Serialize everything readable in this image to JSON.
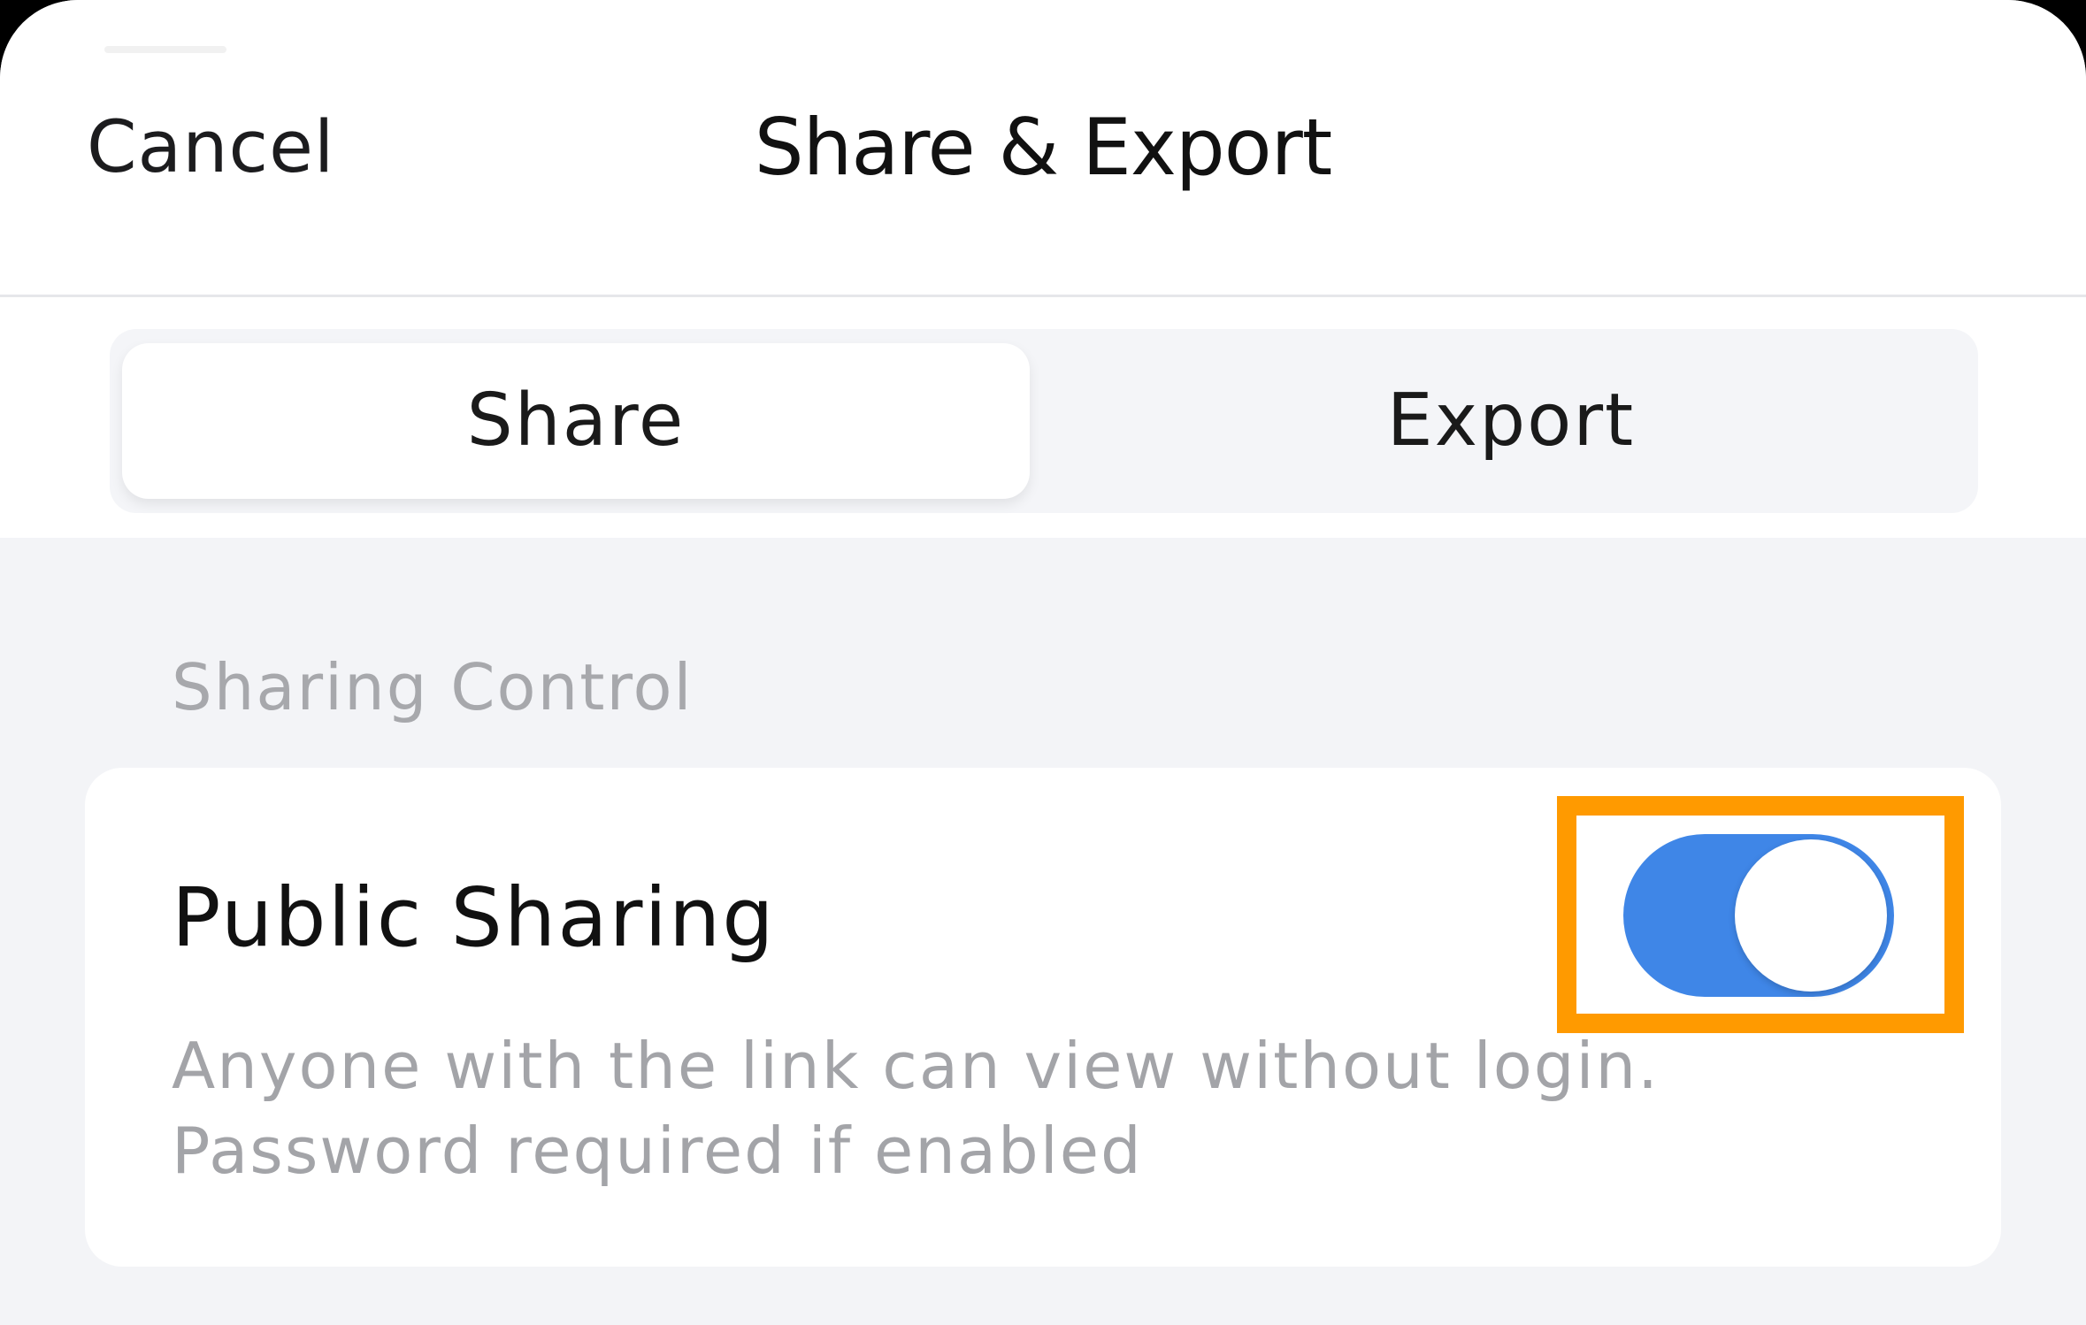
{
  "header": {
    "cancel_label": "Cancel",
    "title": "Share & Export"
  },
  "tabs": [
    {
      "label": "Share",
      "selected": true
    },
    {
      "label": "Export",
      "selected": false
    }
  ],
  "section": {
    "label": "Sharing Control"
  },
  "public_sharing": {
    "title": "Public Sharing",
    "description_line1": "Anyone with the link can view without login.",
    "description_line2": "Password required if enabled",
    "enabled": true,
    "toggle_color": "#3f86e7"
  },
  "highlight_color": "#ff9a00"
}
